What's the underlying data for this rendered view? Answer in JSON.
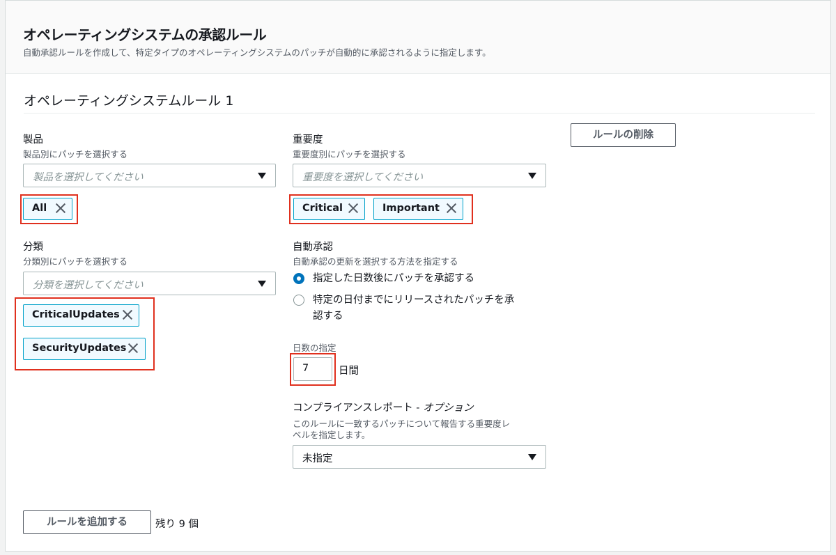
{
  "header": {
    "title": "オペレーティングシステムの承認ルール",
    "description": "自動承認ルールを作成して、特定タイプのオペレーティングシステムのパッチが自動的に承認されるように指定します。"
  },
  "rule": {
    "title": "オペレーティングシステムルール 1",
    "delete_label": "ルールの削除",
    "product": {
      "label": "製品",
      "sublabel": "製品別にパッチを選択する",
      "placeholder": "製品を選択してください",
      "tokens": [
        "All"
      ]
    },
    "severity": {
      "label": "重要度",
      "sublabel": "重要度別にパッチを選択する",
      "placeholder": "重要度を選択してください",
      "tokens": [
        "Critical",
        "Important"
      ]
    },
    "classification": {
      "label": "分類",
      "sublabel": "分類別にパッチを選択する",
      "placeholder": "分類を選択してください",
      "tokens": [
        "CriticalUpdates",
        "SecurityUpdates"
      ]
    },
    "auto_approval": {
      "label": "自動承認",
      "sublabel": "自動承認の更新を選択する方法を指定する",
      "options": [
        {
          "label": "指定した日数後にパッチを承認する",
          "selected": true
        },
        {
          "label_line1": "特定の日付までにリリースされたパッチを承",
          "label_line2": "認する",
          "selected": false
        }
      ]
    },
    "days": {
      "label": "日数の指定",
      "value": "7",
      "unit": "日間"
    },
    "compliance": {
      "label": "コンプライアンスレポート - ",
      "label_optional": "オプション",
      "sublabel_line1": "このルールに一致するパッチについて報告する重要度レ",
      "sublabel_line2": "ベルを指定します。",
      "selected": "未指定"
    }
  },
  "footer": {
    "add_label": "ルールを追加する",
    "remaining": "残り 9 個"
  },
  "colors": {
    "highlight": "#e0301e",
    "token_border": "#00a1c9",
    "radio_selected": "#0073bb"
  }
}
